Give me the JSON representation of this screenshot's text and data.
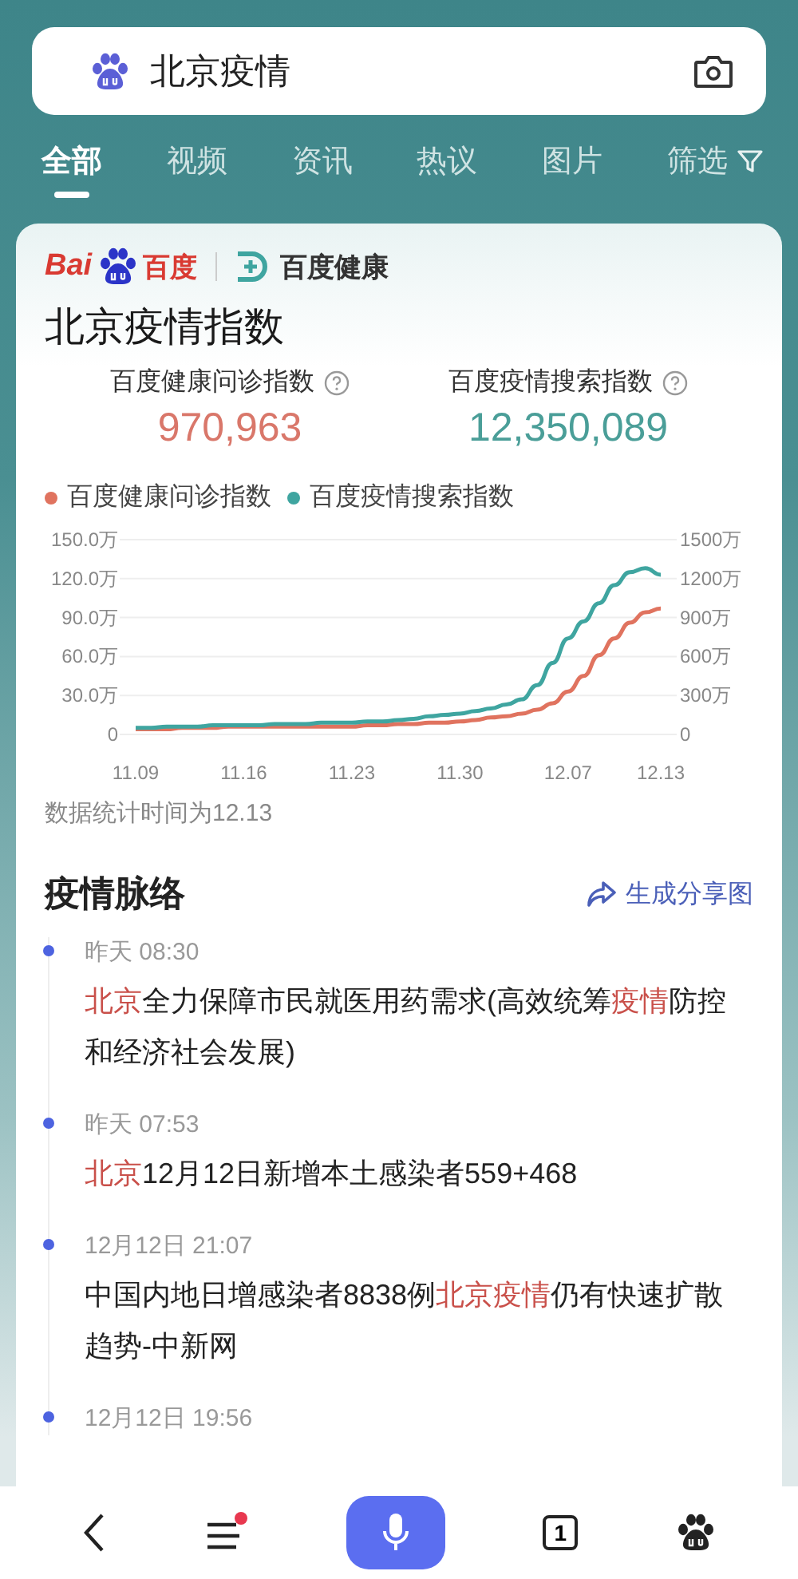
{
  "search": {
    "value": "北京疫情"
  },
  "tabs": [
    {
      "label": "全部",
      "selected": true
    },
    {
      "label": "视频",
      "selected": false
    },
    {
      "label": "资讯",
      "selected": false
    },
    {
      "label": "热议",
      "selected": false
    },
    {
      "label": "图片",
      "selected": false
    },
    {
      "label": "筛选",
      "selected": false,
      "kind": "filter"
    }
  ],
  "card": {
    "brand": {
      "latin": "Bai",
      "cjk": "百度",
      "partner": "百度健康"
    },
    "title": "北京疫情指数",
    "stats": [
      {
        "label": "百度健康问诊指数",
        "value": "970,963",
        "color": "#d9776a"
      },
      {
        "label": "百度疫情搜索指数",
        "value": "12,350,089",
        "color": "#4a9e98"
      }
    ],
    "chart_data": {
      "type": "line",
      "categories": [
        "11.09",
        null,
        null,
        null,
        null,
        null,
        null,
        "11.16",
        null,
        null,
        null,
        null,
        null,
        null,
        "11.23",
        null,
        null,
        null,
        null,
        null,
        null,
        "11.30",
        null,
        null,
        null,
        null,
        null,
        null,
        "12.07",
        null,
        null,
        null,
        null,
        null,
        "12.13"
      ],
      "grid": true,
      "ylim": [
        0,
        150
      ],
      "yticks": [
        {
          "value": 0,
          "label": "0"
        },
        {
          "value": 30,
          "label": "30.0万"
        },
        {
          "value": 60,
          "label": "60.0万"
        },
        {
          "value": 90,
          "label": "90.0万"
        },
        {
          "value": 120,
          "label": "120.0万"
        },
        {
          "value": 150,
          "label": "150.0万"
        }
      ],
      "y2lim": [
        0,
        1500
      ],
      "y2ticks": [
        {
          "value": 0,
          "label": "0"
        },
        {
          "value": 300,
          "label": "300万"
        },
        {
          "value": 600,
          "label": "600万"
        },
        {
          "value": 900,
          "label": "900万"
        },
        {
          "value": 1200,
          "label": "1200万"
        },
        {
          "value": 1500,
          "label": "1500万"
        }
      ],
      "series": [
        {
          "name": "百度健康问诊指数",
          "color": "#e0735f",
          "values": [
            4,
            4,
            4,
            5,
            5,
            5,
            6,
            6,
            6,
            6,
            6,
            6,
            6,
            6,
            6,
            7,
            7,
            8,
            8,
            9,
            9,
            10,
            11,
            13,
            14,
            16,
            19,
            24,
            33,
            45,
            61,
            74,
            86,
            94,
            97
          ]
        },
        {
          "name": "百度疫情搜索指数",
          "color": "#3fa5a0",
          "axis": "y2",
          "values": [
            50,
            50,
            60,
            60,
            60,
            70,
            70,
            70,
            70,
            80,
            80,
            80,
            90,
            90,
            90,
            100,
            100,
            110,
            120,
            140,
            150,
            160,
            180,
            200,
            230,
            270,
            380,
            550,
            740,
            870,
            1010,
            1150,
            1250,
            1280,
            1230
          ]
        }
      ]
    },
    "note": "数据统计时间为12.13"
  },
  "timeline": {
    "title": "疫情脉络",
    "share": "生成分享图",
    "items": [
      {
        "time": "昨天 08:30",
        "parts": [
          {
            "text": "北京",
            "highlight": true
          },
          {
            "text": "全力保障市民就医用药需求(高效统筹",
            "highlight": false
          },
          {
            "text": "疫情",
            "highlight": true
          },
          {
            "text": "防控和经济社会发展)",
            "highlight": false
          }
        ]
      },
      {
        "time": "昨天 07:53",
        "parts": [
          {
            "text": "北京",
            "highlight": true
          },
          {
            "text": "12月12日新增本土感染者559+468",
            "highlight": false
          }
        ]
      },
      {
        "time": "12月12日 21:07",
        "parts": [
          {
            "text": "中国内地日增感染者8838例",
            "highlight": false
          },
          {
            "text": "北京疫情",
            "highlight": true
          },
          {
            "text": "仍有快速扩散趋势-中新网",
            "highlight": false
          }
        ]
      },
      {
        "time": "12月12日 19:56"
      }
    ]
  },
  "bottom_bar": {
    "menu_dot": true,
    "tab_count": "1"
  }
}
